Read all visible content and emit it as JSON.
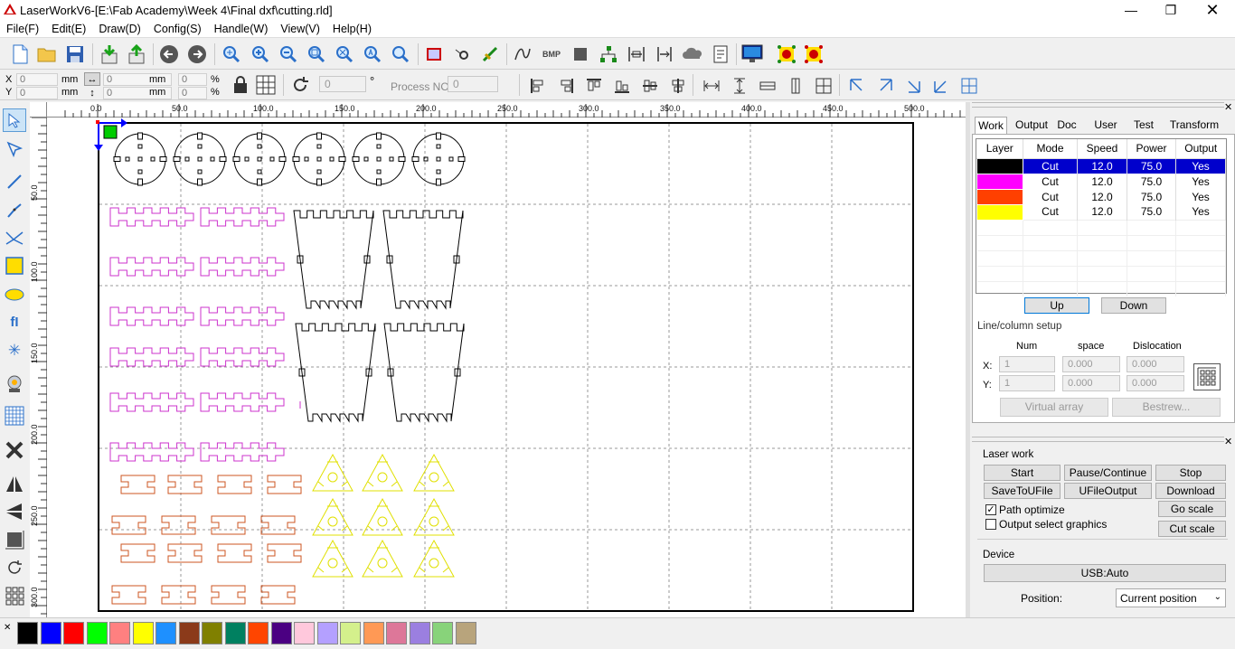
{
  "window": {
    "title": "LaserWorkV6-[E:\\Fab Academy\\Week 4\\Final dxf\\cutting.rld]"
  },
  "menu": [
    "File(F)",
    "Edit(E)",
    "Draw(D)",
    "Config(S)",
    "Handle(W)",
    "View(V)",
    "Help(H)"
  ],
  "props": {
    "x_label": "X",
    "y_label": "Y",
    "x_value": "0",
    "y_value": "0",
    "unit": "mm",
    "w_value": "0",
    "h_value": "0",
    "sx_value": "0",
    "sy_value": "0",
    "pct": "%",
    "rotate_value": "0",
    "degree": "°",
    "process_label": "Process NO:",
    "process_value": "0"
  },
  "ruler": {
    "h_ticks": [
      "0.0",
      "50.0",
      "100.0",
      "150.0",
      "200.0",
      "250.0",
      "300.0",
      "350.0",
      "400.0",
      "450.0",
      "500.0"
    ],
    "v_ticks": [
      "50.0",
      "100.0",
      "150.0",
      "200.0",
      "250.0",
      "300.0"
    ]
  },
  "panel": {
    "tabs": [
      "Work",
      "Output",
      "Doc",
      "User",
      "Test",
      "Transform"
    ],
    "active_tab": "Work",
    "layer_headers": [
      "Layer",
      "Mode",
      "Speed",
      "Power",
      "Output"
    ],
    "layers": [
      {
        "color": "#000000",
        "mode": "Cut",
        "speed": "12.0",
        "power": "75.0",
        "output": "Yes",
        "selected": true
      },
      {
        "color": "#ff00ff",
        "mode": "Cut",
        "speed": "12.0",
        "power": "75.0",
        "output": "Yes",
        "selected": false
      },
      {
        "color": "#ff4000",
        "mode": "Cut",
        "speed": "12.0",
        "power": "75.0",
        "output": "Yes",
        "selected": false
      },
      {
        "color": "#ffff00",
        "mode": "Cut",
        "speed": "12.0",
        "power": "75.0",
        "output": "Yes",
        "selected": false
      }
    ],
    "up_label": "Up",
    "down_label": "Down",
    "linecol_title": "Line/column setup",
    "col_num": "Num",
    "col_space": "space",
    "col_disloc": "Dislocation",
    "x_label": "X:",
    "y_label": "Y:",
    "x_num": "1",
    "x_space": "0.000",
    "x_disloc": "0.000",
    "y_num": "1",
    "y_space": "0.000",
    "y_disloc": "0.000",
    "virtual_array": "Virtual array",
    "bestrew": "Bestrew...",
    "laser_work_title": "Laser work",
    "start": "Start",
    "pause": "Pause/Continue",
    "stop": "Stop",
    "save_to_u": "SaveToUFile",
    "ufile_output": "UFileOutput",
    "download": "Download",
    "path_optimize": "Path optimize",
    "output_select": "Output select graphics",
    "go_scale": "Go scale",
    "cut_scale": "Cut scale",
    "device_title": "Device",
    "device_value": "USB:Auto",
    "position_label": "Position:",
    "position_value": "Current position"
  },
  "palette": [
    "#000000",
    "#0000ff",
    "#ff0000",
    "#00ff00",
    "#ff8080",
    "#ffff00",
    "#1e90ff",
    "#8b3a1a",
    "#808000",
    "#008060",
    "#ff4500",
    "#4b0082",
    "#ffc8dc",
    "#b4a0ff",
    "#d4f08c",
    "#ff9955",
    "#dd7799",
    "#9b7fe0",
    "#88d37a",
    "#b8a47c"
  ],
  "colors": {
    "black": "#000000",
    "magenta": "#cc33cc",
    "orange": "#cc5522",
    "yellow": "#e0e000",
    "selected_row": "#0000cc"
  }
}
